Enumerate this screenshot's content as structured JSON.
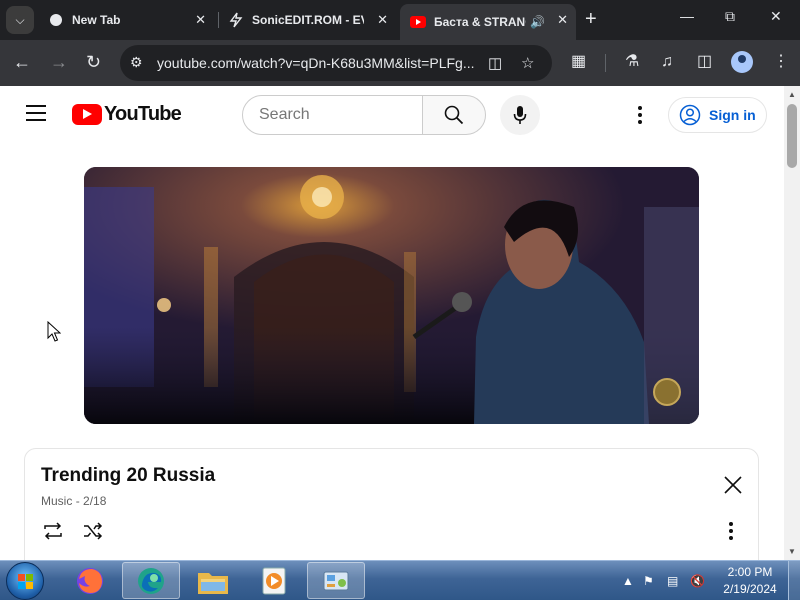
{
  "browser": {
    "tabs": [
      {
        "title": "New Tab",
        "favicon": "globe-icon",
        "active": false
      },
      {
        "title": "SonicEDIT.ROM - EV",
        "favicon": "sonicedit-icon",
        "active": false
      },
      {
        "title": "Баста & STRANGE",
        "favicon": "youtube-icon",
        "active": true,
        "audio": true
      }
    ],
    "url": "youtube.com/watch?v=qDn-K68u3MM&list=PLFg...",
    "colors": {
      "chrome_dark": "#202124",
      "chrome_toolbar": "#35363a"
    }
  },
  "youtube": {
    "logo_text": "YouTube",
    "search_placeholder": "Search",
    "signin_label": "Sign in",
    "brand_red": "#ff0000",
    "link_blue": "#065fd4"
  },
  "playlist": {
    "title": "Trending 20 Russia",
    "channel": "Music",
    "position": "2/18"
  },
  "taskbar": {
    "apps": [
      "firefox-icon",
      "edge-icon",
      "file-explorer-icon",
      "media-player-icon",
      "control-panel-icon"
    ],
    "clock_time": "2:00 PM",
    "clock_date": "2/19/2024"
  }
}
